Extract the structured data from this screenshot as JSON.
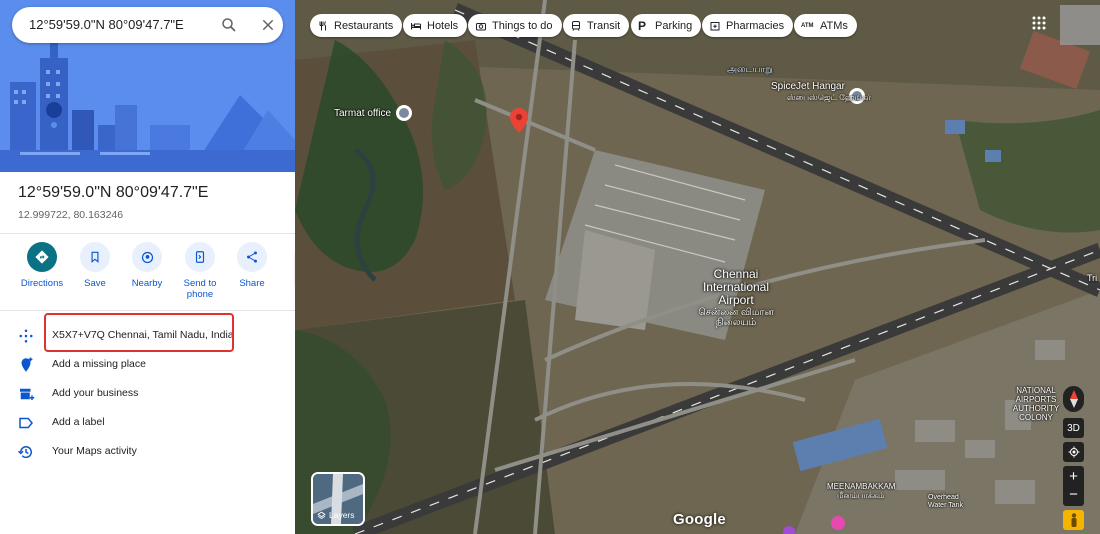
{
  "search": {
    "value": "12°59'59.0\"N 80°09'47.7\"E"
  },
  "place": {
    "title": "12°59'59.0\"N 80°09'47.7\"E",
    "decimal": "12.999722, 80.163246"
  },
  "actions": [
    {
      "label": "Directions",
      "icon": "directions-icon"
    },
    {
      "label": "Save",
      "icon": "bookmark-icon"
    },
    {
      "label": "Nearby",
      "icon": "nearby-icon"
    },
    {
      "label": "Send to phone",
      "icon": "send-to-phone-icon"
    },
    {
      "label": "Share",
      "icon": "share-icon"
    }
  ],
  "info_rows": [
    {
      "label": "X5X7+V7Q Chennai, Tamil Nadu, India",
      "icon": "plus-code-icon"
    },
    {
      "label": "Add a missing place",
      "icon": "add-place-icon"
    },
    {
      "label": "Add your business",
      "icon": "add-business-icon"
    },
    {
      "label": "Add a label",
      "icon": "label-icon"
    },
    {
      "label": "Your Maps activity",
      "icon": "history-icon"
    }
  ],
  "chips": [
    {
      "label": "Restaurants",
      "icon": "restaurant-icon"
    },
    {
      "label": "Hotels",
      "icon": "hotel-icon"
    },
    {
      "label": "Things to do",
      "icon": "camera-icon"
    },
    {
      "label": "Transit",
      "icon": "transit-icon"
    },
    {
      "label": "Parking",
      "icon": "parking-icon"
    },
    {
      "label": "Pharmacies",
      "icon": "pharmacy-icon"
    },
    {
      "label": "ATMs",
      "icon": "atm-icon"
    }
  ],
  "map_labels": {
    "tarmat": "Tarmat office",
    "spicejet": "SpiceJet Hangar",
    "spicejet_tamil": "ஸ்பைஸ்ஜெட் ஹேங்கர்",
    "adyar": "அடையாறு",
    "airport_line1": "Chennai",
    "airport_line2": "International",
    "airport_line3": "Airport",
    "airport_tamil": "சென்னை விமான நிலையம்",
    "naac": "NATIONAL AIRPORTS AUTHORITY COLONY",
    "meenambakkam": "MEENAMBAKKAM",
    "meenambakkam_tamil": "மீனம்பாக்கம்",
    "overhead": "Overhead Water Tank",
    "tri": "Tri",
    "layers": "Layers",
    "google": "Google",
    "three_d": "3D"
  },
  "colors": {
    "accent": "#0b57d0",
    "directions": "#0b7285",
    "highlight_box": "#e03131",
    "pin": "#ea4335"
  }
}
